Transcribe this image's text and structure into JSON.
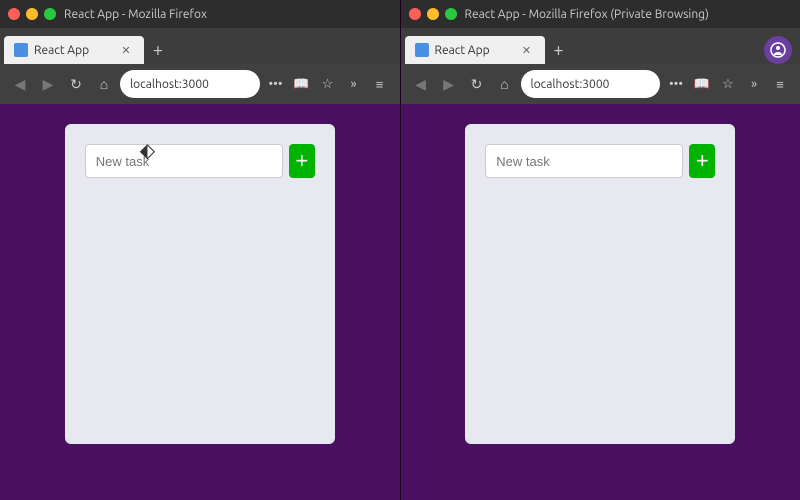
{
  "window1": {
    "os_title": "React App - Mozilla Firefox",
    "tab_label": "React App",
    "url": "localhost:3000",
    "app_title": "React App",
    "input_placeholder": "New task",
    "add_button_label": "+",
    "is_private": false
  },
  "window2": {
    "os_title": "React App - Mozilla Firefox (Private Browsing)",
    "tab_label": "React App",
    "url": "localhost:3000",
    "app_title": "React App",
    "input_placeholder": "New task",
    "add_button_label": "+",
    "is_private": true
  },
  "colors": {
    "background": "#4a1060",
    "card_bg": "#e8e8f0",
    "add_btn": "#00b300",
    "browser_chrome": "#3d3d3d"
  },
  "nav": {
    "back_label": "◀",
    "forward_label": "▶",
    "reload_label": "↻",
    "home_label": "⌂",
    "more_label": "•••",
    "bookmark_label": "☆",
    "bookmarked_label": "★",
    "overflow_label": "»",
    "hamburger_label": "≡"
  }
}
